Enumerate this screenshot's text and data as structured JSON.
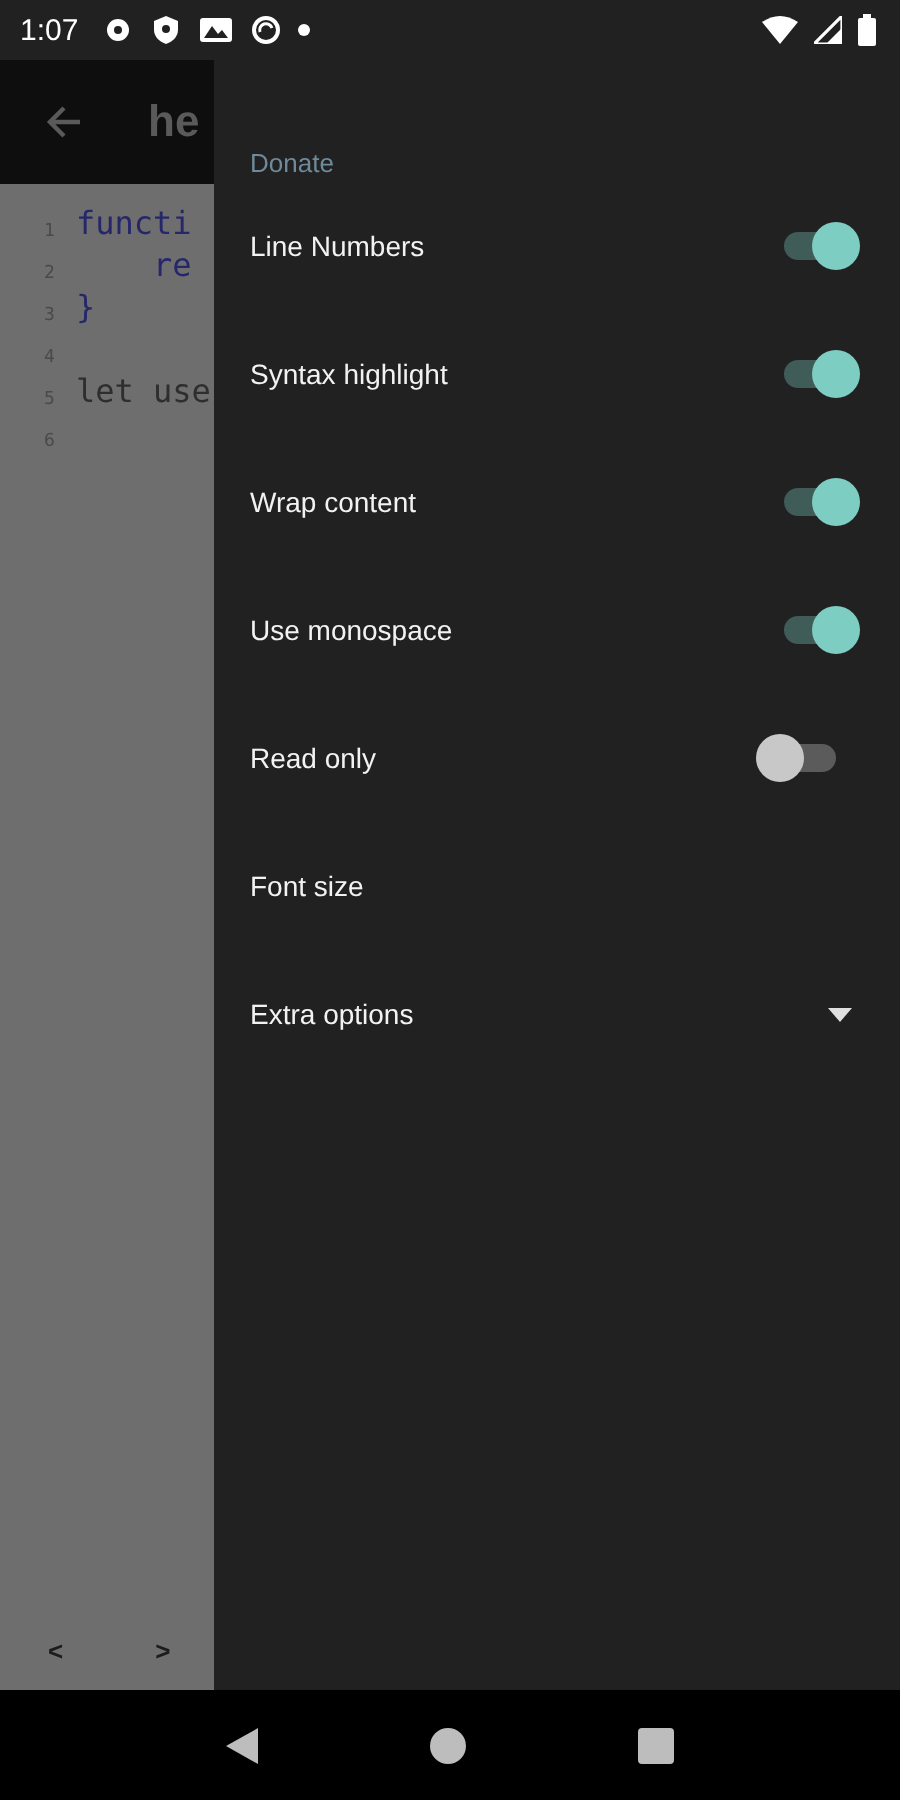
{
  "status_bar": {
    "time": "1:07"
  },
  "app_bar": {
    "title": "he"
  },
  "editor": {
    "lines": [
      {
        "number": "1",
        "code": "functi",
        "kind": "keyword"
      },
      {
        "number": "2",
        "code": "    re",
        "kind": "keyword"
      },
      {
        "number": "3",
        "code": "}",
        "kind": "keyword"
      },
      {
        "number": "4"
      },
      {
        "number": "5",
        "code": "let use",
        "kind": "plain"
      },
      {
        "number": "6"
      }
    ]
  },
  "bottom_keys": [
    "<",
    ">"
  ],
  "drawer": {
    "header": "Donate",
    "items": [
      {
        "kind": "switch",
        "label": "Line Numbers",
        "on": true
      },
      {
        "kind": "switch",
        "label": "Syntax highlight",
        "on": true
      },
      {
        "kind": "switch",
        "label": "Wrap content",
        "on": true
      },
      {
        "kind": "switch",
        "label": "Use monospace",
        "on": true
      },
      {
        "kind": "switch",
        "label": "Read only",
        "on": false
      },
      {
        "kind": "plain",
        "label": "Font size"
      },
      {
        "kind": "dropdown",
        "label": "Extra options"
      }
    ]
  }
}
